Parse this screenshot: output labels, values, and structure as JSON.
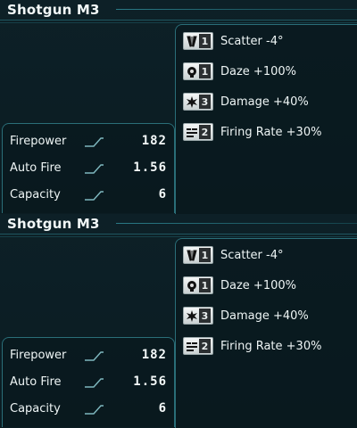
{
  "panels": [
    {
      "title": "Shotgun M3",
      "bonuses": [
        {
          "icon": "scatter-icon",
          "level": "1",
          "text": "Scatter -4°"
        },
        {
          "icon": "daze-icon",
          "level": "1",
          "text": "Daze +100%"
        },
        {
          "icon": "damage-icon",
          "level": "3",
          "text": "Damage +40%"
        },
        {
          "icon": "firing-rate-icon",
          "level": "2",
          "text": "Firing Rate +30%"
        }
      ],
      "stats": [
        {
          "label": "Firepower",
          "value": "182"
        },
        {
          "label": "Auto Fire",
          "value": "1.56"
        },
        {
          "label": "Capacity",
          "value": "6"
        }
      ]
    },
    {
      "title": "Shotgun M3",
      "bonuses": [
        {
          "icon": "scatter-icon",
          "level": "1",
          "text": "Scatter -4°"
        },
        {
          "icon": "daze-icon",
          "level": "1",
          "text": "Daze +100%"
        },
        {
          "icon": "damage-icon",
          "level": "3",
          "text": "Damage +40%"
        },
        {
          "icon": "firing-rate-icon",
          "level": "2",
          "text": "Firing Rate +30%"
        }
      ],
      "stats": [
        {
          "label": "Firepower",
          "value": "182"
        },
        {
          "label": "Auto Fire",
          "value": "1.56"
        },
        {
          "label": "Capacity",
          "value": "6"
        }
      ]
    }
  ],
  "colors": {
    "accent": "#2a6e78",
    "background": "#0a1a1f",
    "text": "#eef5f5"
  }
}
